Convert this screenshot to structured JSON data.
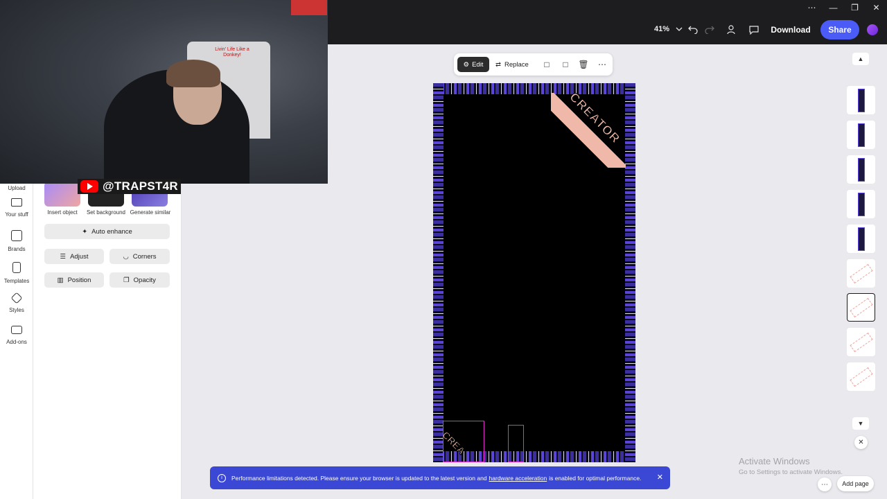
{
  "topbar": {
    "zoom": "41%",
    "download_label": "Download",
    "share_label": "Share",
    "window_controls": [
      "⋯",
      "—",
      "❐",
      "✕"
    ]
  },
  "overlay": {
    "youtube_handle": "@TRAPST4R",
    "shirt_text": "Livin' Life Like a Donkey!"
  },
  "rail": {
    "items": [
      {
        "label": "Upload",
        "icon": "upload-icon"
      },
      {
        "label": "Your stuff",
        "icon": "folder-icon"
      },
      {
        "label": "Brands",
        "icon": "brands-icon"
      },
      {
        "label": "Templates",
        "icon": "templates-icon"
      },
      {
        "label": "Styles",
        "icon": "styles-icon"
      },
      {
        "label": "Add-ons",
        "icon": "addons-icon"
      }
    ]
  },
  "panel": {
    "quick_actions": [
      {
        "label": "Insert object"
      },
      {
        "label": "Set background"
      },
      {
        "label": "Generate similar"
      }
    ],
    "auto_enhance": "Auto enhance",
    "adjust": "Adjust",
    "corners": "Corners",
    "position": "Position",
    "opacity": "Opacity"
  },
  "canvas": {
    "edit_label": "Edit",
    "replace_label": "Replace",
    "artwork": {
      "top_right_text": "CREATOR",
      "bottom_left_text": "CREA"
    }
  },
  "notice": {
    "text_before": "Performance limitations detected. Please ensure your browser is updated to the latest version and",
    "link_text": "hardware acceleration",
    "text_after": "is enabled for optimal performance."
  },
  "watermark": {
    "title": "Activate Windows",
    "subtitle": "Go to Settings to activate Windows."
  },
  "bottom": {
    "add_page_label": "Add page"
  },
  "colors": {
    "accent": "#4a5cf5",
    "notice_bg": "#3b48d6",
    "topbar_bg": "#1d1d1f",
    "border_purple": "#5b45d8",
    "selection": "#e22bd0"
  }
}
